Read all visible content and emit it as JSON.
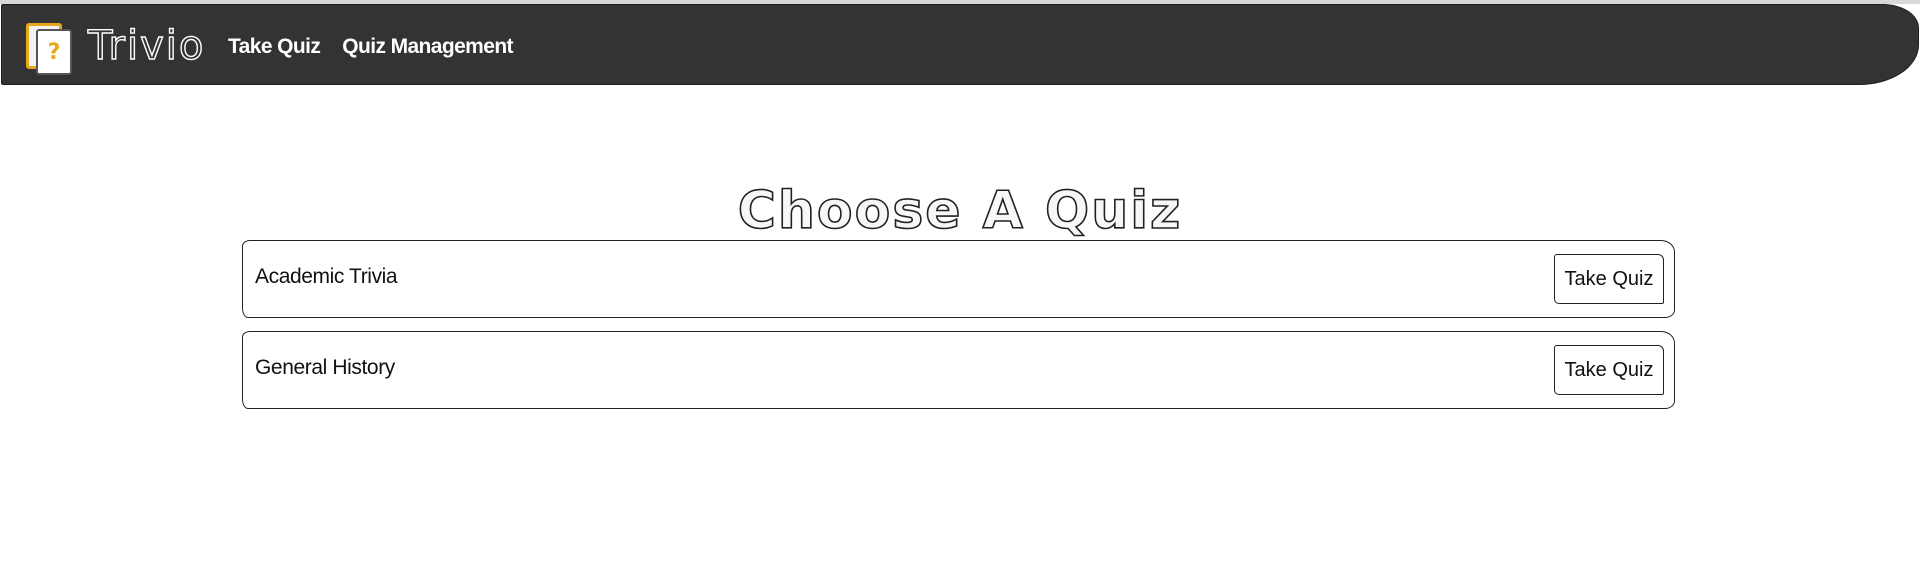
{
  "app": {
    "brand": "Trivio",
    "logo_icon": "quiz-card-question-icon",
    "logo_symbol": "?",
    "accent_color": "#e6a81d",
    "navbar_color": "#333333"
  },
  "nav": {
    "links": [
      {
        "label": "Take Quiz"
      },
      {
        "label": "Quiz Management"
      }
    ]
  },
  "main": {
    "title": "Choose A Quiz",
    "quizzes": [
      {
        "name": "Academic Trivia",
        "action_label": "Take Quiz"
      },
      {
        "name": "General History",
        "action_label": "Take Quiz"
      }
    ]
  }
}
